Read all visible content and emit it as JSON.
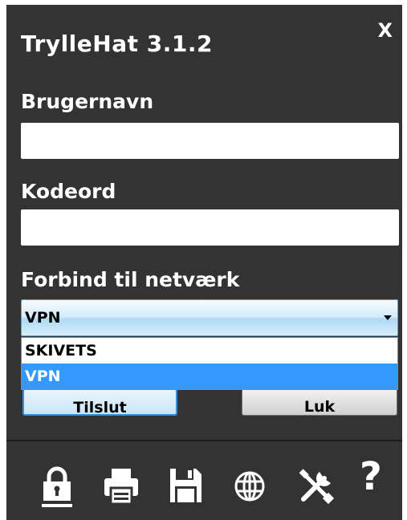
{
  "window": {
    "title": "TrylleHat 3.1.2",
    "close_label": "X"
  },
  "form": {
    "username_label": "Brugernavn",
    "username_value": "",
    "password_label": "Kodeord",
    "password_value": "",
    "network_label": "Forbind til netværk",
    "network_selected": "VPN",
    "network_options": [
      "SKIVETS",
      "VPN"
    ],
    "connect_label": "Tilslut",
    "close_label": "Luk"
  },
  "toolbar": {
    "icons": [
      "lock-icon",
      "printer-icon",
      "save-icon",
      "globe-icon",
      "tools-icon",
      "help-icon"
    ],
    "help_glyph": "?"
  },
  "colors": {
    "background": "#333333",
    "text": "#ffffff",
    "selection": "#3399ff",
    "select_accent": "#5ea0d6"
  }
}
